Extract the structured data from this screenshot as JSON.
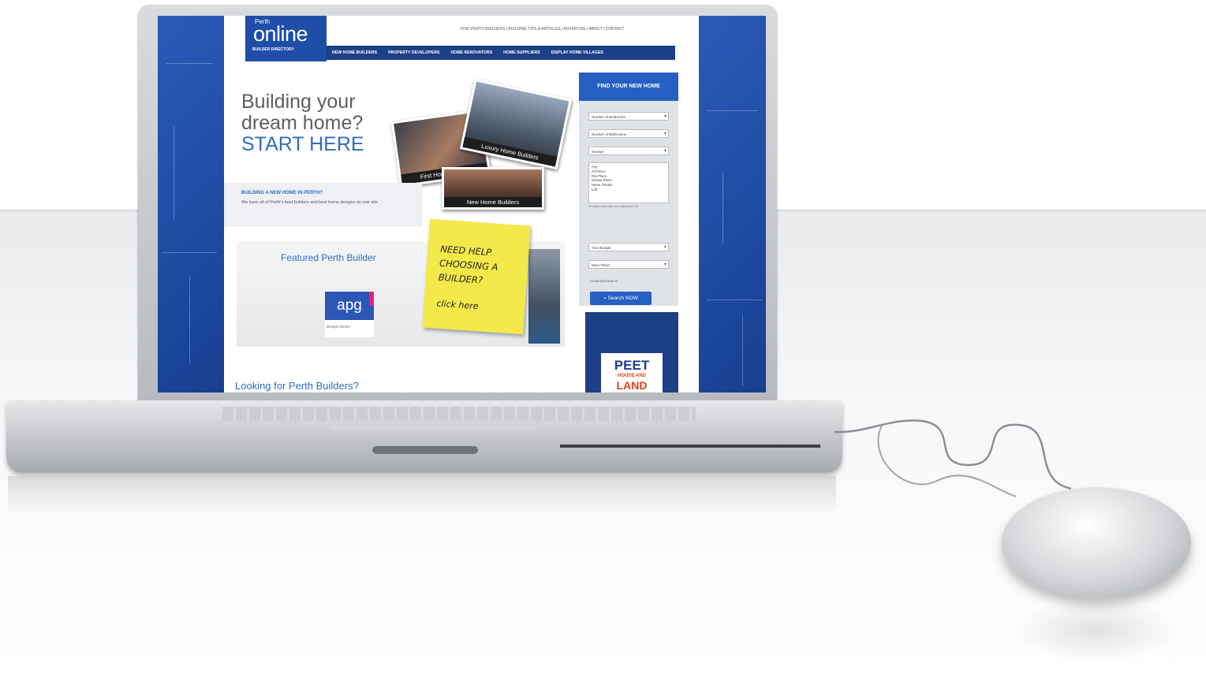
{
  "site": {
    "logo_small": "Perth",
    "logo_big": "online",
    "logo_tag": "BUILDER DIRECTORY",
    "top_links": "FIND PERTH BUILDERS | BUILDING TIPS & ARTICLES | ADVERTISE | ABOUT | CONTACT",
    "nav": [
      "NEW HOME BUILDERS",
      "PROPERTY DEVELOPERS",
      "HOME RENOVATORS",
      "HOME SUPPLIERS",
      "DISPLAY HOME VILLAGES"
    ]
  },
  "hero": {
    "line1": "Building your",
    "line2": "dream home?",
    "line3": "START HERE"
  },
  "photos": {
    "first": "First Home Buyers",
    "luxury": "Luxury Home Builders",
    "new": "New Home Builders"
  },
  "strip": {
    "heading": "BUILDING A NEW HOME IN PERTH?",
    "text": "We have all of Perth's best builders and best home designs on one site"
  },
  "featured": {
    "title": "Featured Perth Builder",
    "logo": "apg",
    "logo_sub": "lifestyle homes"
  },
  "note": {
    "text": "NEED HELP CHOOSING A BUILDER?",
    "click": "click here"
  },
  "looking": "Looking for Perth Builders?",
  "finder": {
    "title": "FIND YOUR NEW HOME",
    "bedrooms": "Number of Bedrooms",
    "bathrooms": "Number of Bathrooms",
    "storeys": "Storeys",
    "list_items": [
      "Any",
      "Al Fresco",
      "Fire Place",
      "Games Room",
      "Home Theatre",
      "Loft"
    ],
    "hint": "To select more than one, hold down Ctrl",
    "budget": "Your Budget",
    "filters": "More Filters",
    "advanced": "Advanced Search",
    "search_button": "Search NOW"
  },
  "ad": {
    "line1": "PEET",
    "line2": "HOUSE AND",
    "line3": "LAND"
  },
  "colors": {
    "brand_blue": "#2f6cc0",
    "nav_blue": "#1c3f86",
    "note_yellow": "#f4e94a"
  }
}
